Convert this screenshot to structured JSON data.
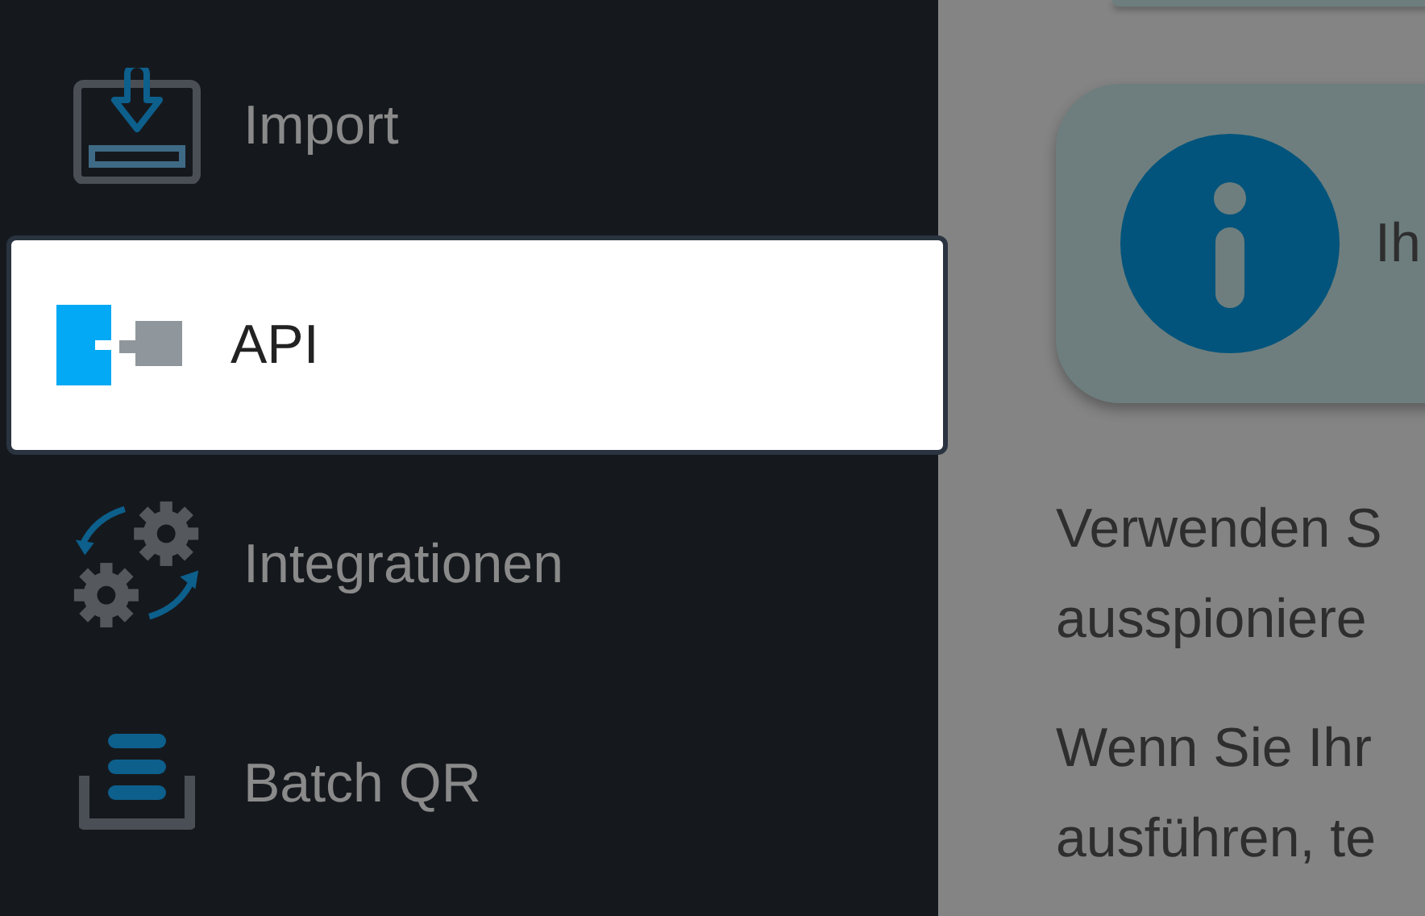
{
  "sidebar": {
    "items": [
      {
        "label": "Import",
        "kind": "import",
        "selected": false
      },
      {
        "label": "API",
        "kind": "api",
        "selected": true
      },
      {
        "label": "Integrationen",
        "kind": "integrations",
        "selected": false
      },
      {
        "label": "Batch QR",
        "kind": "batch",
        "selected": false
      }
    ]
  },
  "content": {
    "info_card": {
      "text": "Ih"
    },
    "paragraphs": [
      [
        "Verwenden S",
        "ausspioniere"
      ],
      [
        "Wenn Sie Ihr",
        "ausführen, te"
      ]
    ]
  }
}
